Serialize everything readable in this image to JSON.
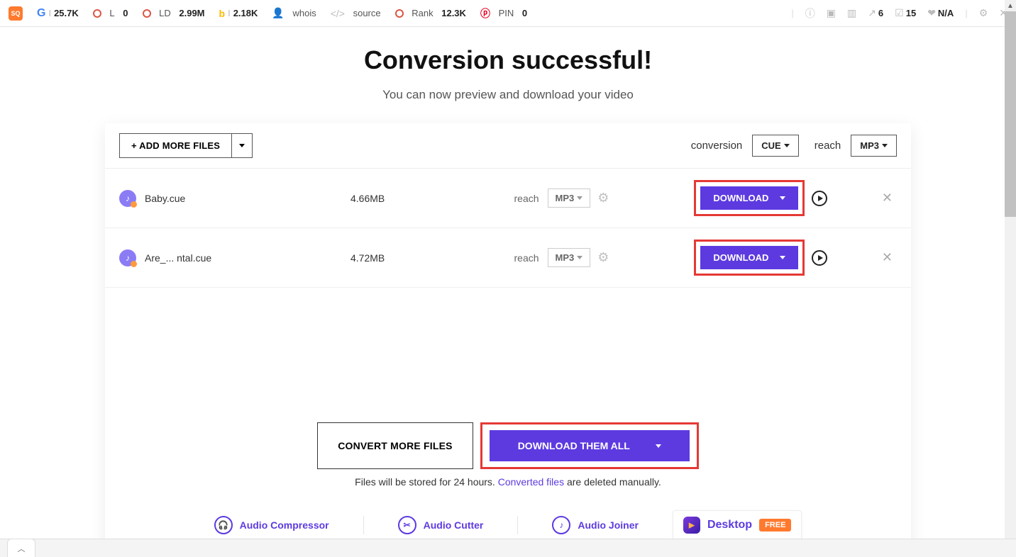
{
  "extbar": {
    "google_value": "25.7K",
    "l_label": "L",
    "l_value": "0",
    "ld_label": "LD",
    "ld_value": "2.99M",
    "bing_value": "2.18K",
    "whois": "whois",
    "source": "source",
    "rank_label": "Rank",
    "rank_value": "12.3K",
    "pin_label": "PIN",
    "pin_value": "0",
    "right_arrow_value": "6",
    "right_check_value": "15",
    "right_na": "N/A"
  },
  "page": {
    "title": "Conversion successful!",
    "subtitle": "You can now preview and download your video"
  },
  "header": {
    "add_more_label": "+ ADD MORE FILES",
    "conversion_label": "conversion",
    "conversion_value": "CUE",
    "reach_label": "reach",
    "reach_value": "MP3"
  },
  "files": [
    {
      "name": "Baby.cue",
      "size": "4.66MB",
      "reach": "reach",
      "format": "MP3",
      "download": "DOWNLOAD"
    },
    {
      "name": "Are_... ntal.cue",
      "size": "4.72MB",
      "reach": "reach",
      "format": "MP3",
      "download": "DOWNLOAD"
    }
  ],
  "actions": {
    "convert_more": "CONVERT MORE FILES",
    "download_all": "DOWNLOAD THEM ALL",
    "storage_prefix": "Files will be stored for 24 hours. ",
    "storage_link": "Converted files",
    "storage_suffix": " are deleted manually."
  },
  "tools": {
    "compressor": "Audio Compressor",
    "cutter": "Audio Cutter",
    "joiner": "Audio Joiner",
    "desktop": "Desktop",
    "free": "FREE"
  }
}
